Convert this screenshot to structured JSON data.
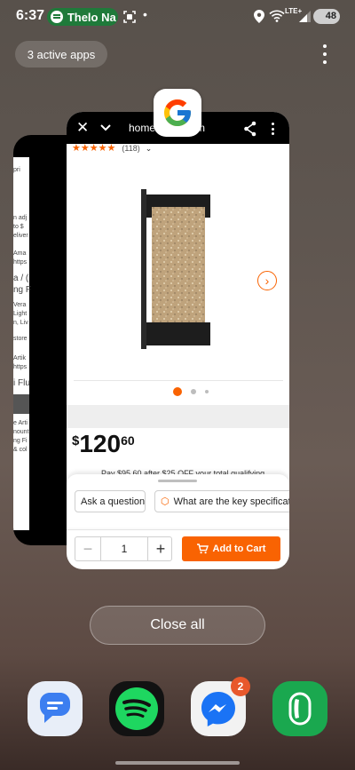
{
  "status_bar": {
    "time": "6:37",
    "spotify_label": "Thelo Na",
    "battery": "48",
    "network": "LTE+",
    "icons": [
      "spotify-icon",
      "screenshot-icon",
      "location-icon",
      "wifi-icon",
      "signal-icon",
      "battery-icon"
    ]
  },
  "recents": {
    "active_apps_label": "3 active apps",
    "close_all_label": "Close all"
  },
  "back_card": {
    "snippets": [
      "pri",
      "n adj",
      "to $",
      "eliver",
      "Ama",
      "https",
      "a / (",
      "ng F",
      "Vera",
      "Light",
      "n, Liv",
      "store",
      "Artik",
      "https",
      "i Flu",
      "e Arti",
      "nount",
      "ng Fi",
      "& col"
    ]
  },
  "browser_card": {
    "host": "homedepot.com",
    "rating_count": "(118)",
    "price": {
      "currency": "$",
      "dollars": "120",
      "cents": "60"
    },
    "promo_text": "Pay $95.60 after $25 OFF your total qualifying",
    "chips": [
      "Ask a question",
      "What are the key specifications"
    ],
    "quantity": "1",
    "minus": "−",
    "plus": "+",
    "add_to_cart_label": "Add to Cart",
    "carousel_dots": 3,
    "carousel_active_dot": 1
  },
  "dock": {
    "apps": [
      "messages-app",
      "spotify-app",
      "messenger-app",
      "phone-app"
    ],
    "messenger_badge": "2"
  },
  "colors": {
    "accent": "#f96302",
    "spotify_green": "#1ed760",
    "badge": "#e8582c"
  }
}
